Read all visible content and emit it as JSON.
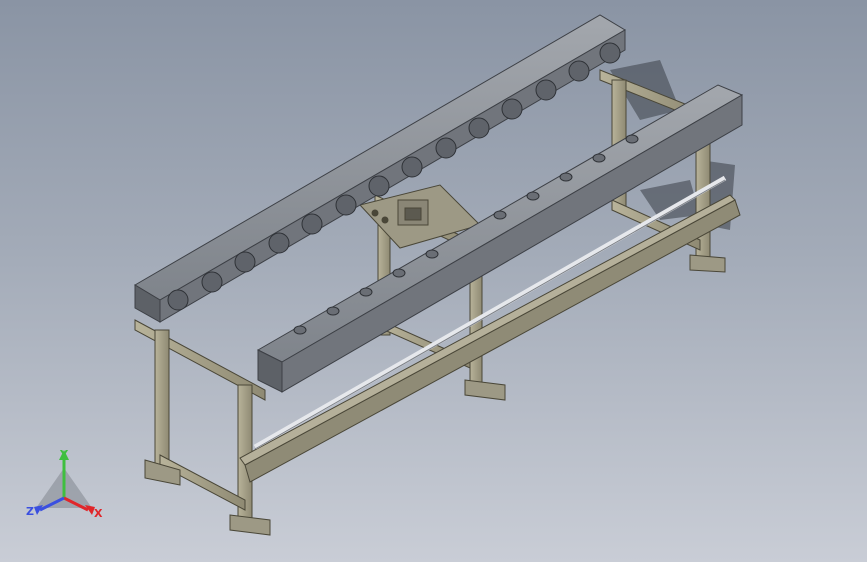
{
  "viewport": {
    "background_top": "#8a94a4",
    "background_bottom": "#c9cdd6"
  },
  "triad": {
    "x_label": "X",
    "y_label": "Y",
    "z_label": "Z",
    "x_color": "#e0262a",
    "y_color": "#3fbf3f",
    "z_color": "#3a4fe0"
  },
  "model": {
    "frame_color": "#a9a48d",
    "frame_shadow": "#6f6b58",
    "roller_color": "#6c7077",
    "beam_color": "#8b8f95"
  }
}
